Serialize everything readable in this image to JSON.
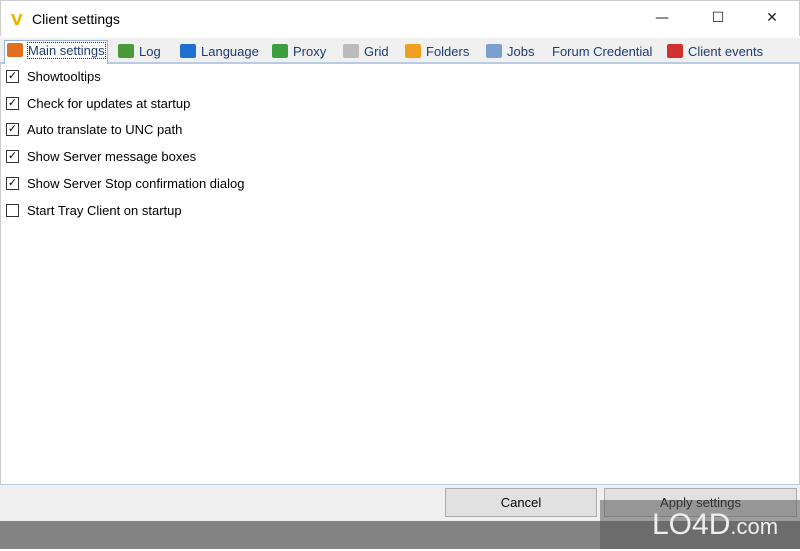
{
  "window": {
    "title": "Client settings",
    "minimize": "—",
    "maximize": "☐",
    "close": "✕"
  },
  "tabs": [
    {
      "label": "Main settings",
      "icon": "gear-icon",
      "color": "#e07020",
      "active": true
    },
    {
      "label": "Log",
      "icon": "log-icon",
      "color": "#4a9a3a"
    },
    {
      "label": "Language",
      "icon": "flag-icon",
      "color": "#1f6fd0"
    },
    {
      "label": "Proxy",
      "icon": "proxy-icon",
      "color": "#3aa040"
    },
    {
      "label": "Grid",
      "icon": "grid-icon",
      "color": "#bbbbbb"
    },
    {
      "label": "Folders",
      "icon": "folders-icon",
      "color": "#f0a020"
    },
    {
      "label": "Jobs",
      "icon": "jobs-icon",
      "color": "#7aa0d0"
    },
    {
      "label": "Forum Credential",
      "icon": "",
      "color": ""
    },
    {
      "label": "Client events",
      "icon": "events-icon",
      "color": "#d03030"
    }
  ],
  "options": [
    {
      "label": "Showtooltips",
      "checked": true
    },
    {
      "label": "Check for updates at startup",
      "checked": true
    },
    {
      "label": "Auto translate to UNC path",
      "checked": true
    },
    {
      "label": "Show Server message boxes",
      "checked": true
    },
    {
      "label": "Show Server Stop confirmation dialog",
      "checked": true
    },
    {
      "label": "Start Tray Client on startup",
      "checked": false
    }
  ],
  "buttons": {
    "cancel": "Cancel",
    "apply": "Apply settings"
  },
  "watermark": "LO4D.com"
}
